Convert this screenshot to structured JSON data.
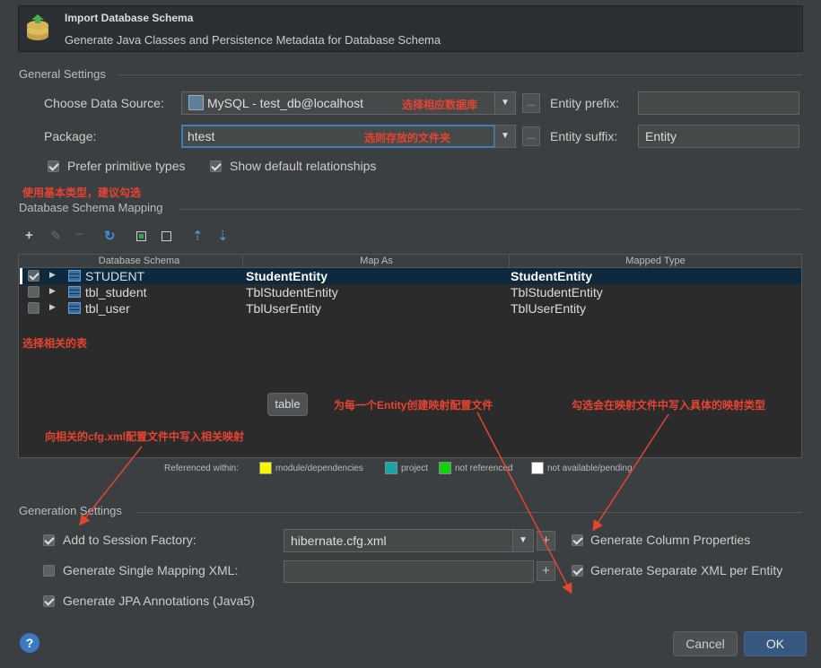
{
  "header": {
    "title": "Import Database Schema",
    "subtitle": "Generate Java Classes and Persistence Metadata for Database Schema"
  },
  "general": {
    "section_title": "General Settings",
    "data_source_label": "Choose Data Source:",
    "data_source_value": "MySQL - test_db@localhost",
    "package_label": "Package:",
    "package_value": "htest",
    "entity_prefix_label": "Entity prefix:",
    "entity_prefix_value": "",
    "entity_suffix_label": "Entity suffix:",
    "entity_suffix_value": "Entity",
    "prefer_primitive_label": "Prefer primitive types",
    "prefer_primitive_checked": true,
    "show_relationships_label": "Show default relationships",
    "show_relationships_checked": true,
    "ellipsis": "..."
  },
  "mapping": {
    "section_title": "Database Schema Mapping",
    "columns": [
      "Database Schema",
      "Map As",
      "Mapped Type"
    ],
    "rows": [
      {
        "checked": true,
        "schema": "STUDENT",
        "map_as": "StudentEntity",
        "mapped_type": "StudentEntity"
      },
      {
        "checked": false,
        "schema": "tbl_student",
        "map_as": "TblStudentEntity",
        "mapped_type": "TblStudentEntity"
      },
      {
        "checked": false,
        "schema": "tbl_user",
        "map_as": "TblUserEntity",
        "mapped_type": "TblUserEntity"
      }
    ],
    "legend": {
      "prefix": "Referenced within:",
      "items": [
        {
          "label": "module/dependencies",
          "color": "#f5f500"
        },
        {
          "label": "project",
          "color": "#16a6a6"
        },
        {
          "label": "not referenced",
          "color": "#10d010"
        },
        {
          "label": "not available/pending",
          "color": "#ffffff"
        }
      ]
    },
    "tooltip": "table"
  },
  "generation": {
    "section_title": "Generation Settings",
    "add_session_label": "Add to Session Factory:",
    "add_session_checked": true,
    "session_value": "hibernate.cfg.xml",
    "single_mapping_label": "Generate Single Mapping XML:",
    "single_mapping_checked": false,
    "single_mapping_value": "",
    "jpa_label": "Generate JPA Annotations (Java5)",
    "jpa_checked": true,
    "column_props_label": "Generate Column Properties",
    "column_props_checked": true,
    "separate_xml_label": "Generate Separate XML per Entity",
    "separate_xml_checked": true,
    "plus": "+"
  },
  "footer": {
    "help": "?",
    "cancel": "Cancel",
    "ok": "OK"
  },
  "annotations": {
    "datasource_note": "选择相应数据库",
    "package_note": "选则存放的文件夹",
    "primitive_note": "使用基本类型，建议勾选",
    "table_note": "选择相关的表",
    "cfg_note": "向相关的cfg.xml配置文件中写入相关映射",
    "entity_note": "为每一个Entity创建映射配置文件",
    "type_note": "勾选会在映射文件中写入具体的映射类型"
  },
  "colors": {
    "annotation_red": "#e64430",
    "selection_blue": "#0d293e",
    "accent": "#3d7ec2"
  }
}
